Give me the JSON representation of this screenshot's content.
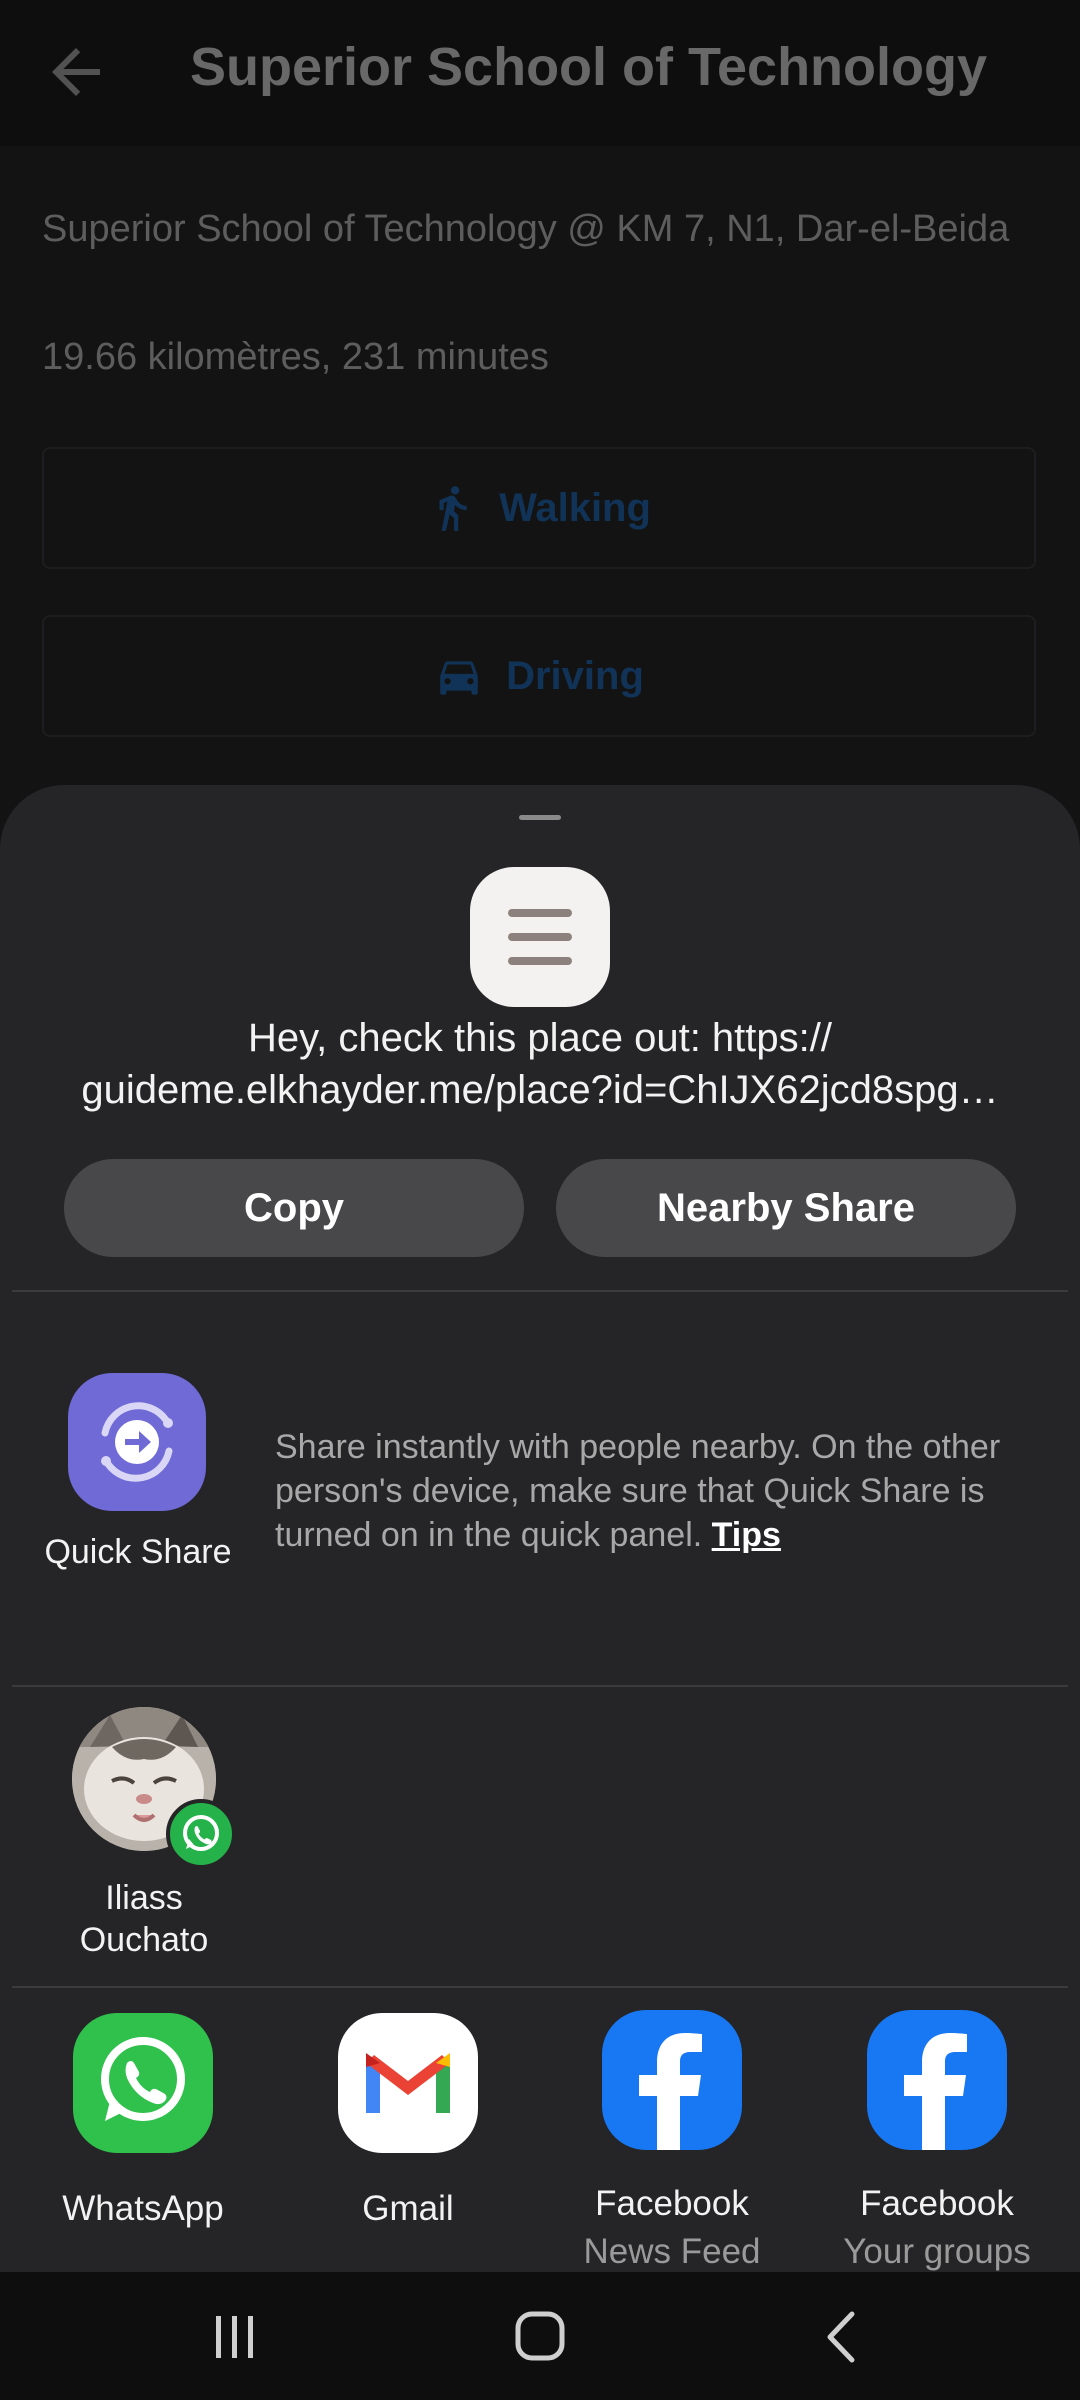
{
  "app": {
    "title": "Superior School of Technology",
    "address": "Superior School of Technology @ KM 7, N1, Dar-el-Beida",
    "distance": "19.66 kilomètres, 231 minutes",
    "modes": [
      {
        "label": "Walking",
        "icon": "walking-icon"
      },
      {
        "label": "Driving",
        "icon": "car-icon"
      }
    ],
    "accent_color": "#1a4c82"
  },
  "share_sheet": {
    "text_line1": "Hey, check this place out: https://",
    "text_line2": "guideme.elkhayder.me/place?id=ChIJX62jcd8spg…",
    "copy_label": "Copy",
    "nearby_label": "Nearby Share",
    "quick_share": {
      "label": "Quick Share",
      "description": "Share instantly with people nearby. On the other person's device, make sure that Quick Share is turned on in the quick panel.",
      "tips_label": "Tips"
    },
    "contact": {
      "name_line1": "Iliass",
      "name_line2": "Ouchato",
      "badge_icon": "whatsapp-icon"
    },
    "apps": [
      {
        "name": "WhatsApp",
        "sub": "",
        "icon": "whatsapp-icon"
      },
      {
        "name": "Gmail",
        "sub": "",
        "icon": "gmail-icon"
      },
      {
        "name": "Facebook",
        "sub": "News Feed",
        "icon": "facebook-icon"
      },
      {
        "name": "Facebook",
        "sub": "Your groups",
        "icon": "facebook-icon"
      }
    ]
  },
  "navbar": {
    "buttons": [
      "recents-button",
      "home-button",
      "back-button"
    ]
  }
}
